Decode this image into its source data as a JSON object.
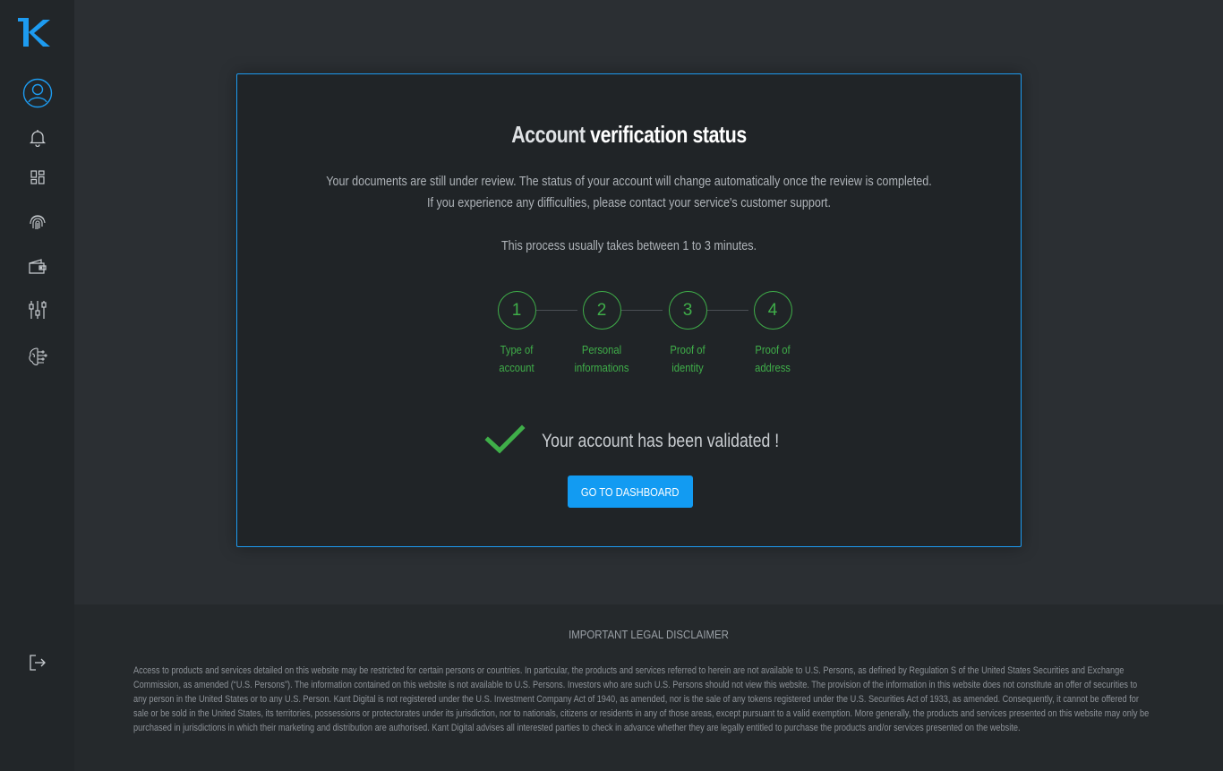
{
  "sidebar": {
    "logo_letter": "K",
    "items": [
      {
        "icon": "user-icon"
      },
      {
        "icon": "bell-icon"
      },
      {
        "icon": "dashboard-icon"
      },
      {
        "icon": "fingerprint-icon"
      },
      {
        "icon": "wallet-icon"
      },
      {
        "icon": "sliders-icon"
      },
      {
        "icon": "brain-icon"
      }
    ],
    "logout_icon": "logout-icon"
  },
  "card": {
    "title_light": "Account ",
    "title_bold": "verification status",
    "desc_line1": "Your documents are still under review. The status of your account will change automatically once the review is completed.",
    "desc_line2": "If you experience any difficulties, please contact your service's customer support.",
    "desc_line3": "This process usually takes between 1 to 3 minutes.",
    "steps": [
      {
        "number": "1",
        "label_line1": "Type of",
        "label_line2": "account"
      },
      {
        "number": "2",
        "label_line1": "Personal",
        "label_line2": "informations"
      },
      {
        "number": "3",
        "label_line1": "Proof of",
        "label_line2": "identity"
      },
      {
        "number": "4",
        "label_line1": "Proof of",
        "label_line2": "address"
      }
    ],
    "validated_text": "Your account has been validated !",
    "dashboard_button": "GO TO DASHBOARD"
  },
  "footer": {
    "disclaimer_title": "IMPORTANT LEGAL DISCLAIMER",
    "disclaimer_text": "Access to products and services detailed on this website may be restricted for certain persons or countries. In particular, the products and services referred to herein are not available to U.S. Persons, as defined by Regulation S of the United States Securities and Exchange Commission, as amended (“U.S. Persons”). The information contained on this website is not available to U.S. Persons. Investors who are such U.S. Persons should not view this website. The provision of the information in this website does not constitute an offer of securities to any person in the United States or to any U.S. Person. Kant Digital is not registered under the U.S. Investment Company Act of 1940, as amended, nor is the sale of any tokens registered under the U.S. Securities Act of 1933, as amended. Consequently, it cannot be offered for sale or be sold in the United States, its territories, possessions or protectorates under its jurisdiction, nor to nationals, citizens or residents in any of those areas, except pursuant to a valid exemption. More generally, the products and services presented on this website may only be purchased in jurisdictions in which their marketing and distribution are authorised. Kant Digital advises all interested parties to check in advance whether they are legally entitled to purchase the products and/or services presented on the website."
  },
  "colors": {
    "accent": "#1d9bf0",
    "success": "#3fae49",
    "background": "#2b2f33",
    "sidebar": "#222629"
  }
}
